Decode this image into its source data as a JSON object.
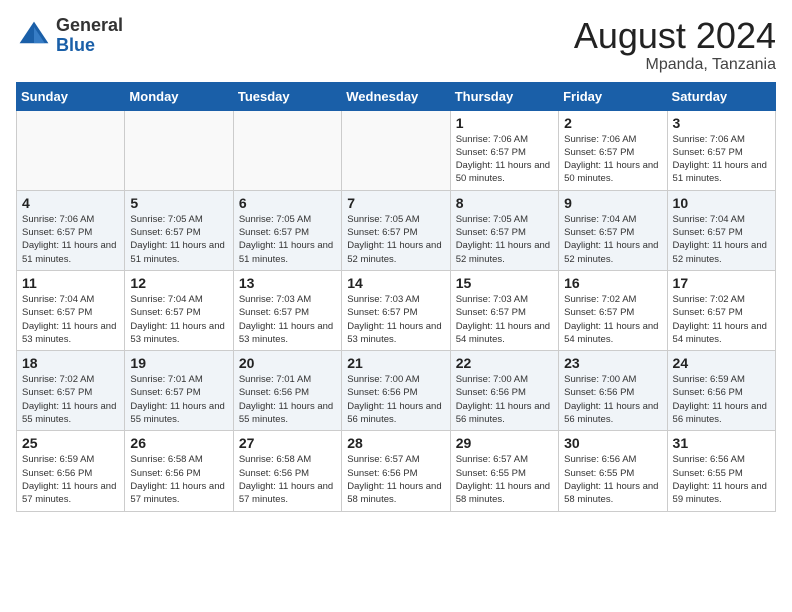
{
  "header": {
    "logo_general": "General",
    "logo_blue": "Blue",
    "month_year": "August 2024",
    "location": "Mpanda, Tanzania"
  },
  "days_of_week": [
    "Sunday",
    "Monday",
    "Tuesday",
    "Wednesday",
    "Thursday",
    "Friday",
    "Saturday"
  ],
  "weeks": [
    [
      {
        "num": "",
        "info": ""
      },
      {
        "num": "",
        "info": ""
      },
      {
        "num": "",
        "info": ""
      },
      {
        "num": "",
        "info": ""
      },
      {
        "num": "1",
        "info": "Sunrise: 7:06 AM\nSunset: 6:57 PM\nDaylight: 11 hours and 50 minutes."
      },
      {
        "num": "2",
        "info": "Sunrise: 7:06 AM\nSunset: 6:57 PM\nDaylight: 11 hours and 50 minutes."
      },
      {
        "num": "3",
        "info": "Sunrise: 7:06 AM\nSunset: 6:57 PM\nDaylight: 11 hours and 51 minutes."
      }
    ],
    [
      {
        "num": "4",
        "info": "Sunrise: 7:06 AM\nSunset: 6:57 PM\nDaylight: 11 hours and 51 minutes."
      },
      {
        "num": "5",
        "info": "Sunrise: 7:05 AM\nSunset: 6:57 PM\nDaylight: 11 hours and 51 minutes."
      },
      {
        "num": "6",
        "info": "Sunrise: 7:05 AM\nSunset: 6:57 PM\nDaylight: 11 hours and 51 minutes."
      },
      {
        "num": "7",
        "info": "Sunrise: 7:05 AM\nSunset: 6:57 PM\nDaylight: 11 hours and 52 minutes."
      },
      {
        "num": "8",
        "info": "Sunrise: 7:05 AM\nSunset: 6:57 PM\nDaylight: 11 hours and 52 minutes."
      },
      {
        "num": "9",
        "info": "Sunrise: 7:04 AM\nSunset: 6:57 PM\nDaylight: 11 hours and 52 minutes."
      },
      {
        "num": "10",
        "info": "Sunrise: 7:04 AM\nSunset: 6:57 PM\nDaylight: 11 hours and 52 minutes."
      }
    ],
    [
      {
        "num": "11",
        "info": "Sunrise: 7:04 AM\nSunset: 6:57 PM\nDaylight: 11 hours and 53 minutes."
      },
      {
        "num": "12",
        "info": "Sunrise: 7:04 AM\nSunset: 6:57 PM\nDaylight: 11 hours and 53 minutes."
      },
      {
        "num": "13",
        "info": "Sunrise: 7:03 AM\nSunset: 6:57 PM\nDaylight: 11 hours and 53 minutes."
      },
      {
        "num": "14",
        "info": "Sunrise: 7:03 AM\nSunset: 6:57 PM\nDaylight: 11 hours and 53 minutes."
      },
      {
        "num": "15",
        "info": "Sunrise: 7:03 AM\nSunset: 6:57 PM\nDaylight: 11 hours and 54 minutes."
      },
      {
        "num": "16",
        "info": "Sunrise: 7:02 AM\nSunset: 6:57 PM\nDaylight: 11 hours and 54 minutes."
      },
      {
        "num": "17",
        "info": "Sunrise: 7:02 AM\nSunset: 6:57 PM\nDaylight: 11 hours and 54 minutes."
      }
    ],
    [
      {
        "num": "18",
        "info": "Sunrise: 7:02 AM\nSunset: 6:57 PM\nDaylight: 11 hours and 55 minutes."
      },
      {
        "num": "19",
        "info": "Sunrise: 7:01 AM\nSunset: 6:57 PM\nDaylight: 11 hours and 55 minutes."
      },
      {
        "num": "20",
        "info": "Sunrise: 7:01 AM\nSunset: 6:56 PM\nDaylight: 11 hours and 55 minutes."
      },
      {
        "num": "21",
        "info": "Sunrise: 7:00 AM\nSunset: 6:56 PM\nDaylight: 11 hours and 56 minutes."
      },
      {
        "num": "22",
        "info": "Sunrise: 7:00 AM\nSunset: 6:56 PM\nDaylight: 11 hours and 56 minutes."
      },
      {
        "num": "23",
        "info": "Sunrise: 7:00 AM\nSunset: 6:56 PM\nDaylight: 11 hours and 56 minutes."
      },
      {
        "num": "24",
        "info": "Sunrise: 6:59 AM\nSunset: 6:56 PM\nDaylight: 11 hours and 56 minutes."
      }
    ],
    [
      {
        "num": "25",
        "info": "Sunrise: 6:59 AM\nSunset: 6:56 PM\nDaylight: 11 hours and 57 minutes."
      },
      {
        "num": "26",
        "info": "Sunrise: 6:58 AM\nSunset: 6:56 PM\nDaylight: 11 hours and 57 minutes."
      },
      {
        "num": "27",
        "info": "Sunrise: 6:58 AM\nSunset: 6:56 PM\nDaylight: 11 hours and 57 minutes."
      },
      {
        "num": "28",
        "info": "Sunrise: 6:57 AM\nSunset: 6:56 PM\nDaylight: 11 hours and 58 minutes."
      },
      {
        "num": "29",
        "info": "Sunrise: 6:57 AM\nSunset: 6:55 PM\nDaylight: 11 hours and 58 minutes."
      },
      {
        "num": "30",
        "info": "Sunrise: 6:56 AM\nSunset: 6:55 PM\nDaylight: 11 hours and 58 minutes."
      },
      {
        "num": "31",
        "info": "Sunrise: 6:56 AM\nSunset: 6:55 PM\nDaylight: 11 hours and 59 minutes."
      }
    ]
  ]
}
